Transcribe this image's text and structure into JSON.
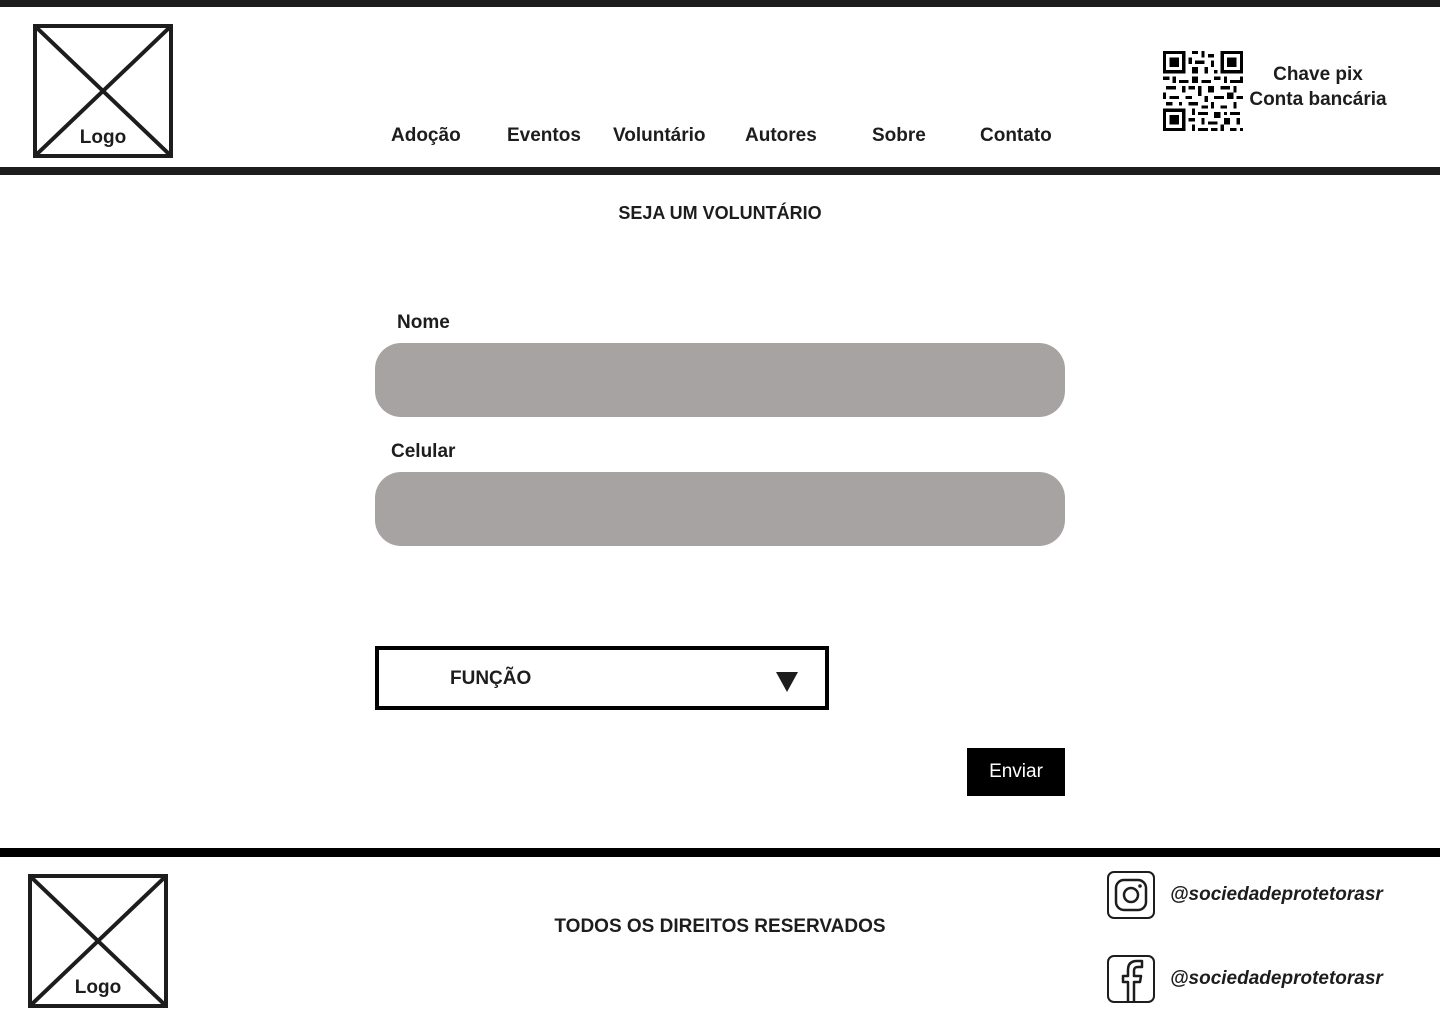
{
  "header": {
    "logo_label": "Logo",
    "nav": [
      "Adoção",
      "Eventos",
      "Voluntário",
      "Autores",
      "Sobre",
      "Contato"
    ],
    "donation": {
      "pix_label": "Chave pix",
      "bank_label": "Conta bancária",
      "icon": "qr-code-icon"
    }
  },
  "main": {
    "title": "SEJA UM VOLUNTÁRIO",
    "fields": {
      "nome": {
        "label": "Nome",
        "value": ""
      },
      "celular": {
        "label": "Celular",
        "value": ""
      }
    },
    "role_select": {
      "selected": "FUNÇÃO",
      "icon": "triangle-down-icon"
    },
    "submit_label": "Enviar"
  },
  "footer": {
    "logo_label": "Logo",
    "copyright": "TODOS OS DIREITOS RESERVADOS",
    "social": [
      {
        "network": "instagram",
        "icon": "instagram-icon",
        "handle": "@sociedadeprotetorasr"
      },
      {
        "network": "facebook",
        "icon": "facebook-icon",
        "handle": "@sociedadeprotetorasr"
      }
    ]
  },
  "colors": {
    "ink": "#1d1d1d",
    "input_fill": "#a7a3a3",
    "button_fill": "#000000",
    "background": "#ffffff"
  }
}
